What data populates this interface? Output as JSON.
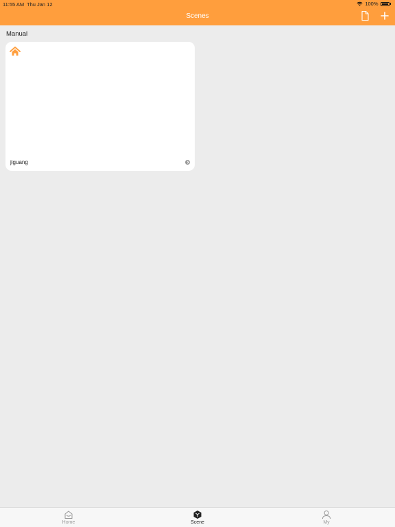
{
  "status_bar": {
    "time": "11:55 AM",
    "date": "Thu Jan 12",
    "battery": "100%",
    "icons": [
      "wifi-icon",
      "battery-icon"
    ]
  },
  "header": {
    "title": "Scenes",
    "background_color": "#ff9e3d",
    "buttons": [
      {
        "name": "document-icon"
      },
      {
        "name": "add-icon"
      }
    ]
  },
  "section": {
    "label": "Manual"
  },
  "scenes": [
    {
      "name": "jiguang",
      "icon": "home-icon",
      "icon_color": "#ff9e3d"
    }
  ],
  "tabbar": {
    "tabs": [
      {
        "label": "Home",
        "icon": "home-tab-icon",
        "active": false
      },
      {
        "label": "Scene",
        "icon": "scene-tab-icon",
        "active": true
      },
      {
        "label": "My",
        "icon": "user-tab-icon",
        "active": false
      }
    ]
  }
}
